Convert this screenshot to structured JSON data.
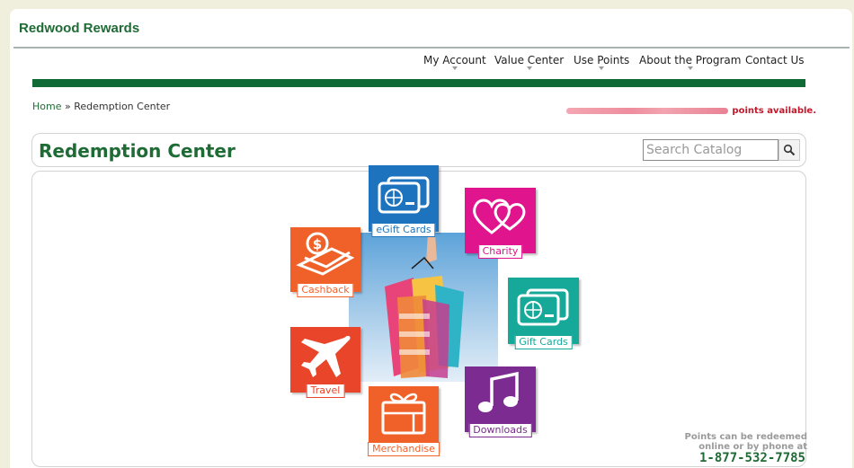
{
  "brand": {
    "name": "Redwood Rewards"
  },
  "nav": {
    "items": [
      {
        "label": "My Account"
      },
      {
        "label": "Value Center"
      },
      {
        "label": "Use Points"
      },
      {
        "label": "About the Program"
      },
      {
        "label": "Contact Us"
      }
    ]
  },
  "breadcrumb": {
    "home": "Home",
    "separator": "»",
    "current": "Redemption Center"
  },
  "points": {
    "label": "points available."
  },
  "page": {
    "title": "Redemption Center"
  },
  "search": {
    "placeholder": "Search Catalog"
  },
  "categories": [
    {
      "label": "eGift Cards",
      "color": "#1e73be",
      "icon": "egift-card-icon"
    },
    {
      "label": "Charity",
      "color": "#e0148c",
      "icon": "hearts-icon"
    },
    {
      "label": "Cashback",
      "color": "#f0612a",
      "icon": "cash-icon"
    },
    {
      "label": "Gift Cards",
      "color": "#16a99a",
      "icon": "gift-card-icon"
    },
    {
      "label": "Travel",
      "color": "#e8452b",
      "icon": "airplane-icon"
    },
    {
      "label": "Downloads",
      "color": "#7c2c91",
      "icon": "music-note-icon"
    },
    {
      "label": "Merchandise",
      "color": "#f0612a",
      "icon": "gift-box-icon"
    }
  ],
  "footer": {
    "note_line1": "Points can be redeemed",
    "note_line2": "online or by phone at",
    "phone": "1-877-532-7785"
  }
}
